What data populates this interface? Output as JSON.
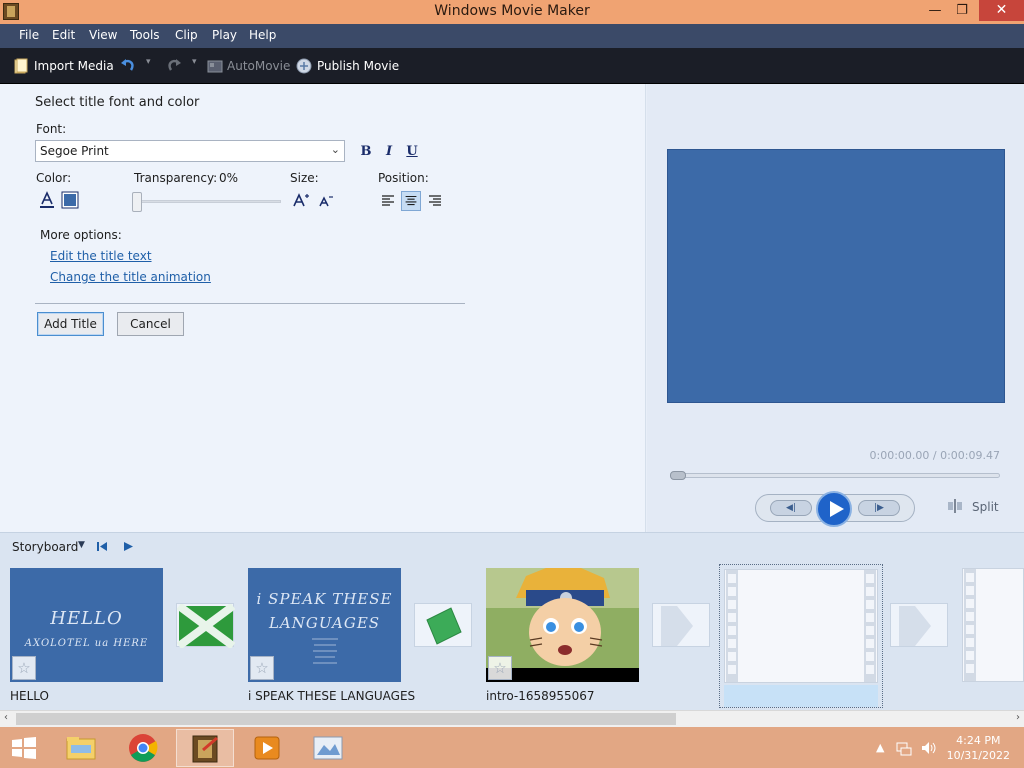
{
  "window": {
    "title": "Windows Movie Maker",
    "controls": {
      "minimize": "—",
      "maximize": "❐",
      "close": "✕"
    }
  },
  "menu": [
    "File",
    "Edit",
    "View",
    "Tools",
    "Clip",
    "Play",
    "Help"
  ],
  "toolbar": {
    "import_media": "Import Media",
    "automovie": "AutoMovie",
    "publish_movie": "Publish Movie"
  },
  "title_panel": {
    "heading": "Select title font and color",
    "font_label": "Font:",
    "font_value": "Segoe Print",
    "bold": "B",
    "italic": "I",
    "underline": "U",
    "color_label": "Color:",
    "transparency_label": "Transparency:",
    "transparency_value": "0%",
    "transparency_level": 0,
    "size_label": "Size:",
    "position_label": "Position:",
    "position_selected": "center",
    "more_options_label": "More options:",
    "link_edit_text": "Edit the title text",
    "link_change_animation": "Change the title animation",
    "add_title_button": "Add Title",
    "cancel_button": "Cancel"
  },
  "preview": {
    "color": "#3c6aa8",
    "timecode": "0:00:00.00 / 0:00:09.47",
    "position_fraction": 0,
    "split_label": "Split",
    "prev_glyph": "◀|",
    "next_glyph": "|▶"
  },
  "storyboard": {
    "label": "Storyboard",
    "clips": [
      {
        "label": "HELLO",
        "thumb_line1": "HELLO",
        "thumb_line2": "AXOLOTEL ua HERE",
        "type": "title"
      },
      {
        "label": "i SPEAK THESE LANGUAGES",
        "thumb_line1": "i SPEAK THESE",
        "thumb_line2": "LANGUAGES",
        "type": "title"
      },
      {
        "label": "intro-1658955067",
        "type": "video"
      }
    ]
  },
  "taskbar": {
    "time": "4:24 PM",
    "date": "10/31/2022"
  }
}
